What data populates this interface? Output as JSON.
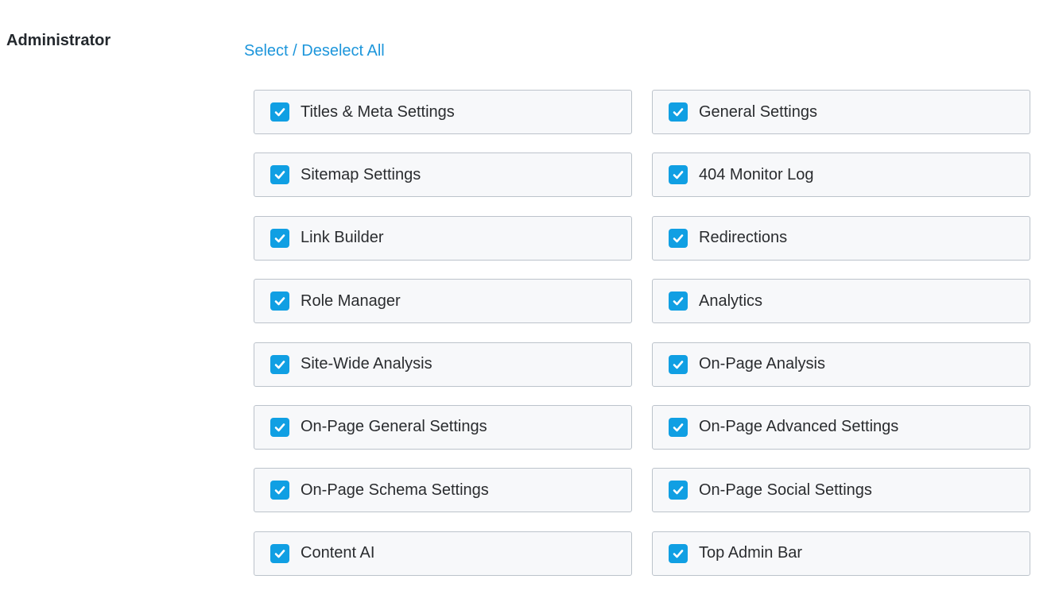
{
  "role": {
    "name": "Administrator"
  },
  "select_all_label": "Select / Deselect All",
  "colors": {
    "accent": "#109fe3",
    "link": "#1d96db"
  },
  "capabilities": [
    {
      "label": "Titles & Meta Settings",
      "checked": true
    },
    {
      "label": "General Settings",
      "checked": true
    },
    {
      "label": "Sitemap Settings",
      "checked": true
    },
    {
      "label": "404 Monitor Log",
      "checked": true
    },
    {
      "label": "Link Builder",
      "checked": true
    },
    {
      "label": "Redirections",
      "checked": true
    },
    {
      "label": "Role Manager",
      "checked": true
    },
    {
      "label": "Analytics",
      "checked": true
    },
    {
      "label": "Site-Wide Analysis",
      "checked": true
    },
    {
      "label": "On-Page Analysis",
      "checked": true
    },
    {
      "label": "On-Page General Settings",
      "checked": true
    },
    {
      "label": "On-Page Advanced Settings",
      "checked": true
    },
    {
      "label": "On-Page Schema Settings",
      "checked": true
    },
    {
      "label": "On-Page Social Settings",
      "checked": true
    },
    {
      "label": "Content AI",
      "checked": true
    },
    {
      "label": "Top Admin Bar",
      "checked": true
    }
  ]
}
